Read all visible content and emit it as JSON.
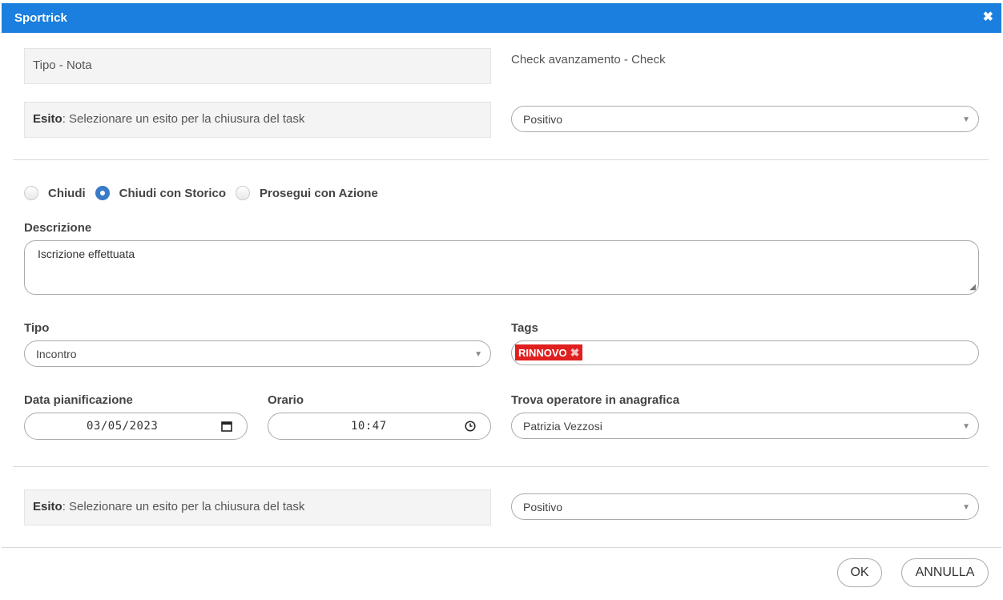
{
  "dialog": {
    "title": "Sportrick",
    "close_icon": "close-icon"
  },
  "top": {
    "tipo_box": "Tipo - Nota",
    "check_text": "Check avanzamento - Check",
    "esito_bold": "Esito",
    "esito_text": ": Selezionare un esito per la chiusura del task",
    "esito_select": "Positivo"
  },
  "radios": [
    {
      "label": "Chiudi",
      "checked": false
    },
    {
      "label": "Chiudi con Storico",
      "checked": true
    },
    {
      "label": "Prosegui con Azione",
      "checked": false
    }
  ],
  "descrizione": {
    "label": "Descrizione",
    "value": "Iscrizione effettuata"
  },
  "tipo": {
    "label": "Tipo",
    "value": "Incontro"
  },
  "tags": {
    "label": "Tags",
    "items": [
      "RINNOVO"
    ]
  },
  "data_pianificazione": {
    "label": "Data pianificazione",
    "value": "03/05/2023"
  },
  "orario": {
    "label": "Orario",
    "value": "10:47"
  },
  "operatore": {
    "label": "Trova operatore in anagrafica",
    "value": "Patrizia Vezzosi"
  },
  "bottom": {
    "esito_bold": "Esito",
    "esito_text": ": Selezionare un esito per la chiusura del task",
    "esito_select": "Positivo"
  },
  "buttons": {
    "ok": "OK",
    "annulla": "ANNULLA"
  },
  "colors": {
    "titlebar": "#1a7fde",
    "tag": "#e01f1f",
    "radio_checked": "#3a7bc8"
  }
}
